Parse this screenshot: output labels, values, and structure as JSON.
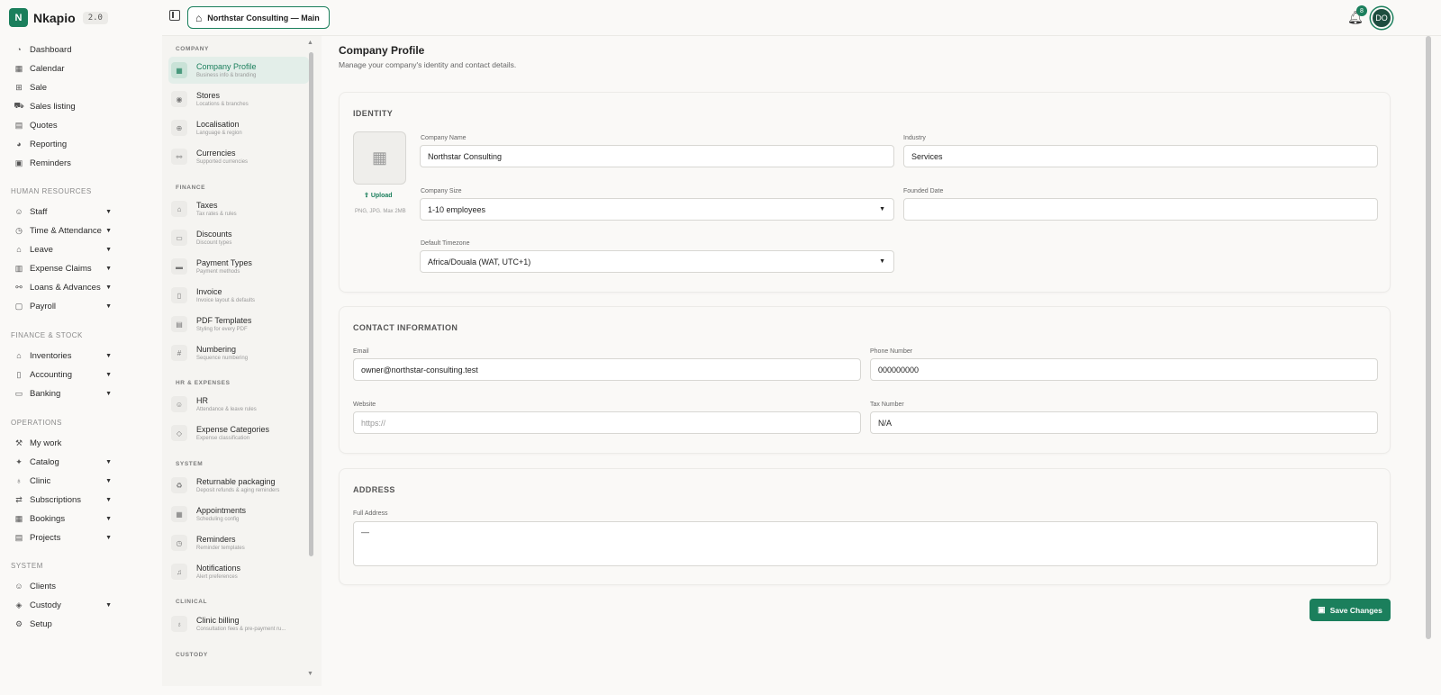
{
  "brand": {
    "name": "Nkapio",
    "version": "2.0",
    "logo_letter": "N",
    "accent": "#1b7f5c"
  },
  "topbar": {
    "store": "Northstar Consulting — Main",
    "notifications": "8",
    "avatar": "DO"
  },
  "sidebar": {
    "main": [
      {
        "label": "Dashboard",
        "icon": "dashboard-icon"
      },
      {
        "label": "Calendar",
        "icon": "calendar-icon"
      },
      {
        "label": "Sale",
        "icon": "sale-icon"
      },
      {
        "label": "Sales listing",
        "icon": "cart-icon"
      },
      {
        "label": "Quotes",
        "icon": "quotes-icon"
      },
      {
        "label": "Reporting",
        "icon": "chart-pie-icon"
      },
      {
        "label": "Reminders",
        "icon": "calendar-check-icon"
      }
    ],
    "sections": [
      {
        "title": "HUMAN RESOURCES",
        "items": [
          {
            "label": "Staff",
            "icon": "users-icon"
          },
          {
            "label": "Time & Attendance",
            "icon": "clock-icon"
          },
          {
            "label": "Leave",
            "icon": "leave-icon"
          },
          {
            "label": "Expense Claims",
            "icon": "receipt-icon"
          },
          {
            "label": "Loans & Advances",
            "icon": "loans-icon"
          },
          {
            "label": "Payroll",
            "icon": "payroll-icon"
          }
        ]
      },
      {
        "title": "FINANCE & STOCK",
        "items": [
          {
            "label": "Inventories",
            "icon": "warehouse-icon"
          },
          {
            "label": "Accounting",
            "icon": "book-icon"
          },
          {
            "label": "Banking",
            "icon": "bank-icon"
          }
        ]
      },
      {
        "title": "OPERATIONS",
        "items": [
          {
            "label": "My work",
            "icon": "wrench-icon"
          },
          {
            "label": "Catalog",
            "icon": "catalog-icon"
          },
          {
            "label": "Clinic",
            "icon": "stethoscope-icon"
          },
          {
            "label": "Subscriptions",
            "icon": "repeat-icon"
          },
          {
            "label": "Bookings",
            "icon": "bookings-icon"
          },
          {
            "label": "Projects",
            "icon": "projects-icon"
          }
        ]
      },
      {
        "title": "SYSTEM",
        "items": [
          {
            "label": "Clients",
            "icon": "user-icon"
          },
          {
            "label": "Custody",
            "icon": "box-icon"
          },
          {
            "label": "Setup",
            "icon": "gear-icon"
          }
        ]
      }
    ]
  },
  "settings": {
    "company_title": "COMPANY",
    "company": [
      {
        "title": "Company Profile",
        "sub": "Business info & branding"
      },
      {
        "title": "Stores",
        "sub": "Locations & branches"
      },
      {
        "title": "Localisation",
        "sub": "Language & region"
      },
      {
        "title": "Currencies",
        "sub": "Supported currencies"
      }
    ],
    "finance_title": "FINANCE",
    "finance": [
      {
        "title": "Taxes",
        "sub": "Tax rates & rules"
      },
      {
        "title": "Discounts",
        "sub": "Discount types"
      },
      {
        "title": "Payment Types",
        "sub": "Payment methods"
      },
      {
        "title": "Invoice",
        "sub": "Invoice layout & defaults"
      },
      {
        "title": "PDF Templates",
        "sub": "Styling for every PDF"
      },
      {
        "title": "Numbering",
        "sub": "Sequence numbering"
      }
    ],
    "hr_title": "HR & EXPENSES",
    "hr": [
      {
        "title": "HR",
        "sub": "Attendance & leave rules"
      },
      {
        "title": "Expense Categories",
        "sub": "Expense classification"
      }
    ],
    "system_title": "SYSTEM",
    "system": [
      {
        "title": "Returnable packaging",
        "sub": "Deposit refunds & aging reminders"
      },
      {
        "title": "Appointments",
        "sub": "Scheduling config"
      },
      {
        "title": "Reminders",
        "sub": "Reminder templates"
      },
      {
        "title": "Notifications",
        "sub": "Alert preferences"
      }
    ],
    "clinical_title": "CLINICAL",
    "clinical": [
      {
        "title": "Clinic billing",
        "sub": "Consultation fees & pre-payment ru..."
      }
    ],
    "custody_title": "CUSTODY"
  },
  "page": {
    "title": "Company Profile",
    "subtitle": "Manage your company's identity and contact details."
  },
  "identity": {
    "title": "IDENTITY",
    "upload": "Upload",
    "upload_hint": "PNG, JPG. Max 2MB",
    "company_name_label": "Company Name",
    "company_name": "Northstar Consulting",
    "industry_label": "Industry",
    "industry": "Services",
    "size_label": "Company Size",
    "size": "1-10 employees",
    "founded_label": "Founded Date",
    "founded": "",
    "timezone_label": "Default Timezone",
    "timezone": "Africa/Douala (WAT, UTC+1)"
  },
  "contact": {
    "title": "CONTACT INFORMATION",
    "email_label": "Email",
    "email": "owner@northstar-consulting.test",
    "phone_label": "Phone Number",
    "phone": "000000000",
    "website_label": "Website",
    "website_placeholder": "https://",
    "tax_label": "Tax Number",
    "tax": "N/A"
  },
  "address": {
    "title": "ADDRESS",
    "label": "Full Address",
    "value": "—"
  },
  "save_label": "Save Changes"
}
